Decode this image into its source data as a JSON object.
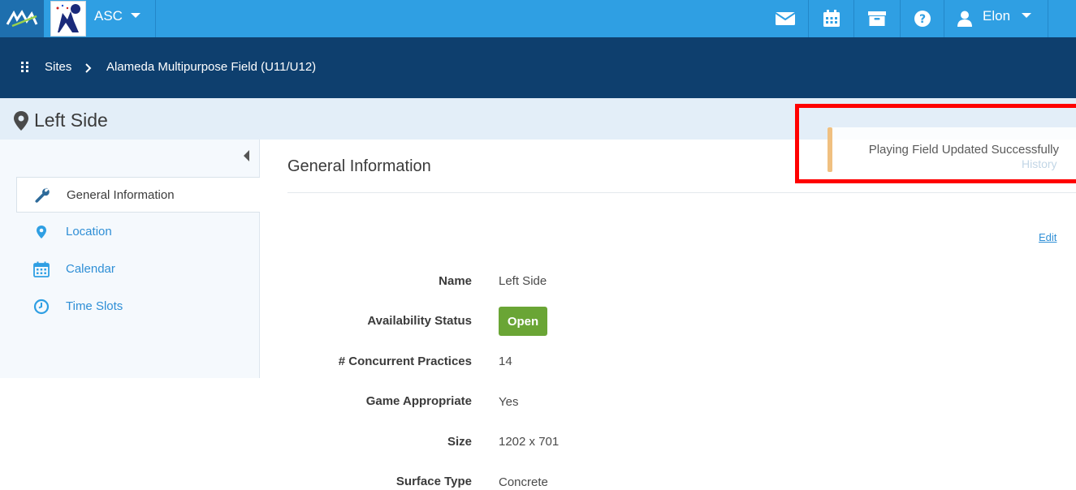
{
  "header": {
    "org_name": "ASC",
    "user_name": "Elon",
    "icons": [
      "logo-icon",
      "envelope-icon",
      "calendar-icon",
      "archive-icon",
      "help-icon",
      "user-icon"
    ],
    "colors": {
      "topbar": "#2f9fe3",
      "breadcrumb": "#0e3f6e",
      "accent": "#2f8fd6"
    }
  },
  "breadcrumb": {
    "items": [
      "Sites",
      "Alameda Multipurpose Field (U11/U12)"
    ]
  },
  "page": {
    "title": "Left Side"
  },
  "sidebar": {
    "items": [
      {
        "label": "General Information",
        "icon": "wrench-icon",
        "active": true
      },
      {
        "label": "Location",
        "icon": "map-marker-icon",
        "active": false
      },
      {
        "label": "Calendar",
        "icon": "calendar-icon",
        "active": false
      },
      {
        "label": "Time Slots",
        "icon": "clock-icon",
        "active": false
      }
    ]
  },
  "main": {
    "section_title": "General Information",
    "edit_label": "Edit",
    "fields": [
      {
        "label": "Name",
        "value": "Left Side"
      },
      {
        "label": "Availability Status",
        "value": "Open"
      },
      {
        "label": "# Concurrent Practices",
        "value": "14"
      },
      {
        "label": "Game Appropriate",
        "value": "Yes"
      },
      {
        "label": "Size",
        "value": "1202 x 701"
      },
      {
        "label": "Surface Type",
        "value": "Concrete"
      }
    ],
    "status_color": "#6aa535"
  },
  "toast": {
    "message": "Playing Field Updated Successfully",
    "history_label": "History",
    "highlight_color": "#ff0000"
  }
}
